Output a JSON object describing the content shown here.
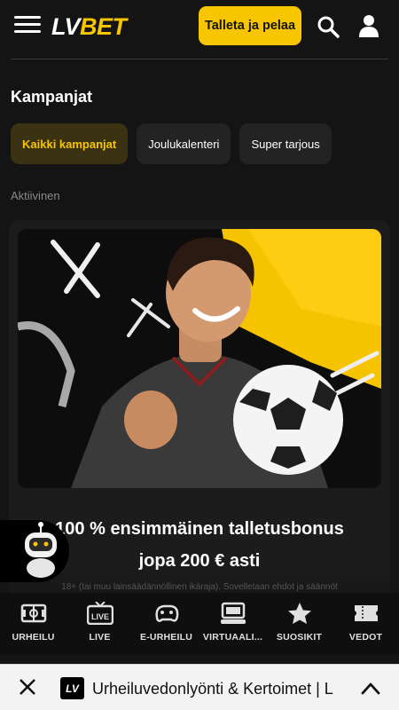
{
  "header": {
    "logo_lv": "LV",
    "logo_bet": "BET",
    "cta_label": "Talleta ja pelaa"
  },
  "page": {
    "title": "Kampanjat",
    "filters": [
      {
        "label": "Kaikki kampanjat",
        "active": true
      },
      {
        "label": "Joulukalenteri",
        "active": false
      },
      {
        "label": "Super tarjous",
        "active": false
      }
    ],
    "section_label": "Aktiivinen"
  },
  "promo": {
    "title_line1": "100 % ensimmäinen talletusbonus",
    "title_line2": "jopa 200 € asti",
    "fine_print": "18+ (tai muu lainsäädännöllinen ikäraja). Sovelletaan ehdot ja säännöt"
  },
  "bottom_nav": [
    {
      "label": "URHEILU",
      "icon": "field-icon"
    },
    {
      "label": "LIVE",
      "icon": "live-tv-icon"
    },
    {
      "label": "E-URHEILU",
      "icon": "gamepad-icon"
    },
    {
      "label": "VIRTUAALI...",
      "icon": "virtual-console-icon"
    },
    {
      "label": "SUOSIKIT",
      "icon": "star-icon"
    },
    {
      "label": "VEDOT",
      "icon": "ticket-icon"
    }
  ],
  "browser_bar": {
    "favicon_text": "LV",
    "page_title": "Urheiluvedonlyönti & Kertoimet | L"
  },
  "colors": {
    "accent": "#f7c600",
    "background": "#141414",
    "chip": "#232323"
  }
}
